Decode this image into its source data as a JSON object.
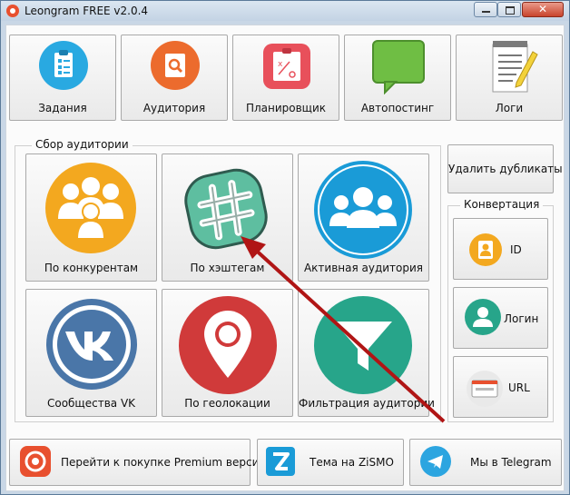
{
  "window": {
    "title": "Leongram FREE v2.0.4",
    "close_glyph": "✕"
  },
  "toolbar": [
    {
      "label": "Задания",
      "icon": "tasks-icon",
      "color": "#29a9e1"
    },
    {
      "label": "Аудитория",
      "icon": "audience-search-icon",
      "color": "#ec6b2d"
    },
    {
      "label": "Планировщик",
      "icon": "planner-icon",
      "color": "#e8505b"
    },
    {
      "label": "Автопостинг",
      "icon": "chat-bubble-icon",
      "color": "#6fbe44"
    },
    {
      "label": "Логи",
      "icon": "log-notepad-icon",
      "color": "#f3d23b"
    }
  ],
  "audience_group": {
    "title": "Сбор аудитории",
    "tiles": [
      {
        "label": "По конкурентам",
        "icon": "competitors-icon",
        "color": "#f3a81f"
      },
      {
        "label": "По хэштегам",
        "icon": "hashtag-icon",
        "color": "#5ebea0"
      },
      {
        "label": "Активная аудитория",
        "icon": "active-audience-icon",
        "color": "#1a9bd7"
      },
      {
        "label": "Сообщества VK",
        "icon": "vk-icon",
        "color": "#4a76a8"
      },
      {
        "label": "По геолокации",
        "icon": "geolocation-icon",
        "color": "#d03a3a"
      },
      {
        "label": "Фильтрация аудитории",
        "icon": "filter-icon",
        "color": "#27a58a"
      }
    ]
  },
  "side": {
    "remove_duplicates": "Удалить дубликаты",
    "conversion_title": "Конвертация",
    "conversion": [
      {
        "label": "ID",
        "icon": "id-user-icon",
        "color": "#f3a81f"
      },
      {
        "label": "Логин",
        "icon": "login-user-icon",
        "color": "#27a58a"
      },
      {
        "label": "URL",
        "icon": "url-browser-icon",
        "color": "#e8502f"
      }
    ]
  },
  "bottom": [
    {
      "label": "Перейти к покупке Premium версии!",
      "icon": "leongram-logo-icon",
      "color": "#e8502f"
    },
    {
      "label": "Тема на ZiSMO",
      "icon": "zismo-logo-icon",
      "color": "#1a9bd7"
    },
    {
      "label": "Мы в Telegram",
      "icon": "telegram-icon",
      "color": "#2ca5e0"
    }
  ]
}
